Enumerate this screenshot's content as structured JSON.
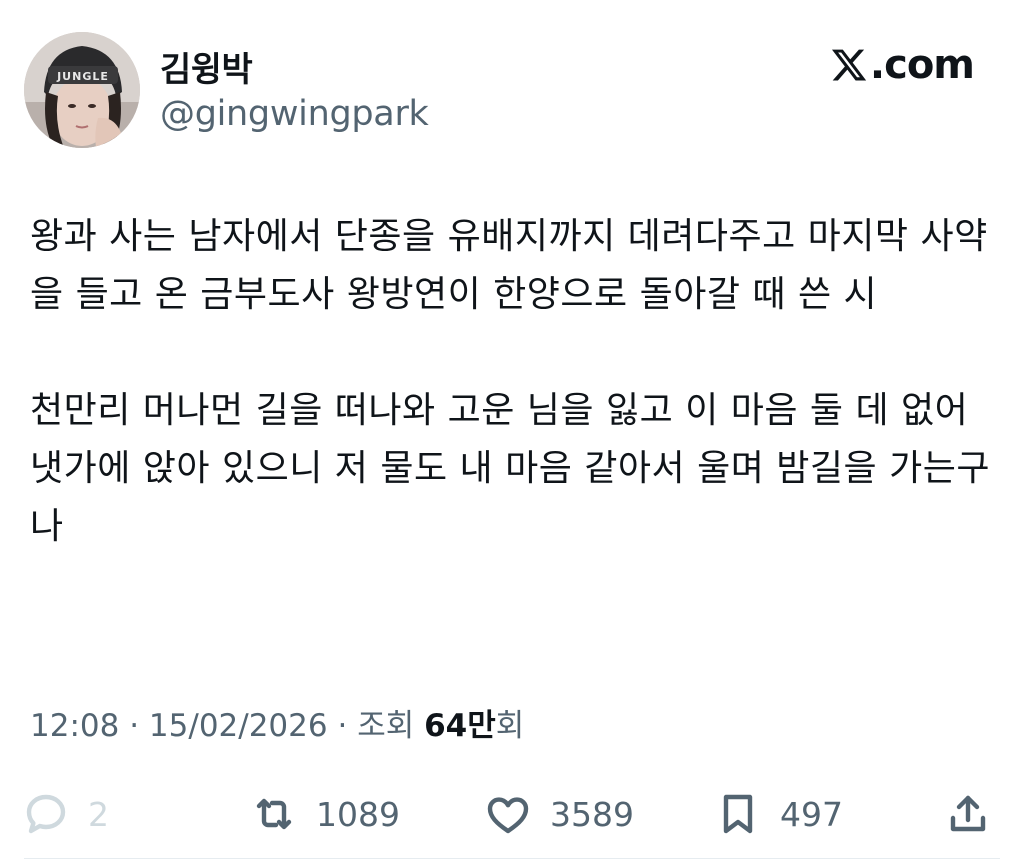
{
  "author": {
    "display_name": "김윙박",
    "handle": "@gingwingpark",
    "avatar_hat_text": "JUNGLE"
  },
  "brand": {
    "label": ".com",
    "icon": "x-logo-icon"
  },
  "tweet": {
    "paragraph1": "왕과 사는 남자에서 단종을 유배지까지 데려다주고 마지막 사약을 들고 온 금부도사 왕방연이 한양으로 돌아갈 때 쓴 시",
    "paragraph2": "천만리 머나먼 길을 떠나와 고운 님을 잃고 이 마음 둘 데 없어 냇가에 앉아 있으니 저 물도 내 마음 같아서 울며 밤길을 가는구나"
  },
  "meta": {
    "time": "12:08",
    "date": "15/02/2026",
    "views_prefix": "조회",
    "views_number": "64만",
    "views_suffix": "회"
  },
  "actions": {
    "replies": "2",
    "retweets": "1089",
    "likes": "3589",
    "bookmarks": "497"
  },
  "colors": {
    "text": "#0f1419",
    "secondary": "#536471",
    "muted": "#cfd9de"
  }
}
